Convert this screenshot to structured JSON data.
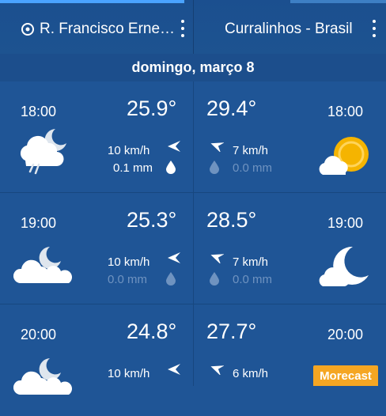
{
  "tabs": [
    {
      "label": "R. Francisco Erne…",
      "icon": "location-target-icon",
      "active": true
    },
    {
      "label": "Curralinhos - Brasil",
      "active": false
    }
  ],
  "date_label": "domingo, março 8",
  "rows": [
    {
      "left": {
        "time": "18:00",
        "temp": "25.9°",
        "wind": "10 km/h",
        "rain": "0.1 mm",
        "weather_icon": "night-cloud-rain-icon"
      },
      "right": {
        "time": "18:00",
        "temp": "29.4°",
        "wind": "7 km/h",
        "rain": "0.0 mm",
        "weather_icon": "sun-cloud-icon"
      }
    },
    {
      "left": {
        "time": "19:00",
        "temp": "25.3°",
        "wind": "10 km/h",
        "rain": "0.0 mm",
        "weather_icon": "night-cloud-icon"
      },
      "right": {
        "time": "19:00",
        "temp": "28.5°",
        "wind": "7 km/h",
        "rain": "0.0 mm",
        "weather_icon": "moon-cloud-icon"
      }
    },
    {
      "left": {
        "time": "20:00",
        "temp": "24.8°",
        "wind": "10 km/h",
        "weather_icon": "night-cloud-icon"
      },
      "right": {
        "time": "20:00",
        "temp": "27.7°",
        "wind": "6 km/h",
        "weather_icon": "moon-cloud-icon"
      }
    }
  ],
  "brand_badge": "Morecast",
  "colors": {
    "background": "#1f5596",
    "accent": "#4aa3ff",
    "sun": "#f5b400",
    "badge": "#f5a623"
  }
}
